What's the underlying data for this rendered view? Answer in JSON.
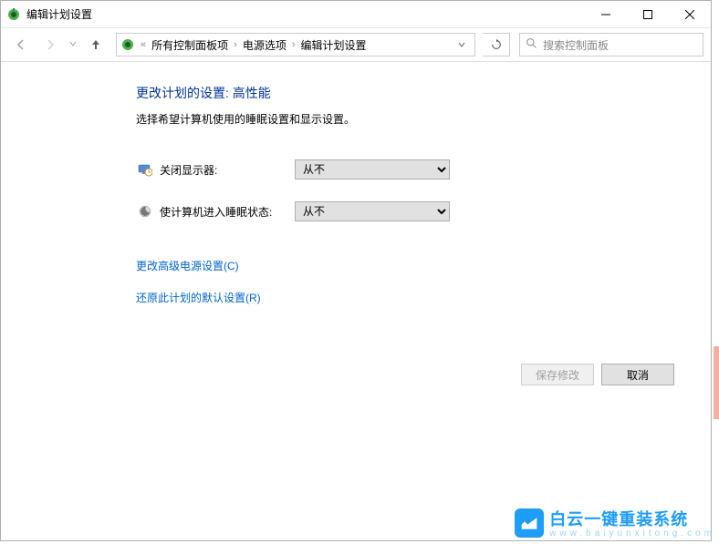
{
  "window": {
    "title": "编辑计划设置"
  },
  "titlebar_buttons": {
    "minimize": "minimize",
    "maximize": "maximize",
    "close": "close"
  },
  "nav": {
    "back": "back",
    "forward": "forward",
    "recent": "recent",
    "up": "up",
    "refresh": "refresh"
  },
  "breadcrumb": {
    "items": [
      "所有控制面板项",
      "电源选项",
      "编辑计划设置"
    ]
  },
  "search": {
    "placeholder": "搜索控制面板"
  },
  "content": {
    "heading_prefix": "更改计划的设置: ",
    "plan_name": "高性能",
    "subtext": "选择希望计算机使用的睡眠设置和显示设置。",
    "rows": [
      {
        "label": "关闭显示器:",
        "value": "从不",
        "icon": "monitor-timer-icon"
      },
      {
        "label": "使计算机进入睡眠状态:",
        "value": "从不",
        "icon": "moon-icon"
      }
    ],
    "select_options": [
      "从不"
    ]
  },
  "links": {
    "advanced": "更改高级电源设置(C)",
    "restore": "还原此计划的默认设置(R)"
  },
  "buttons": {
    "save": "保存修改",
    "cancel": "取消"
  },
  "watermark": {
    "main": "白云一键重装系统",
    "sub": "www.baiyunxitong.com"
  }
}
